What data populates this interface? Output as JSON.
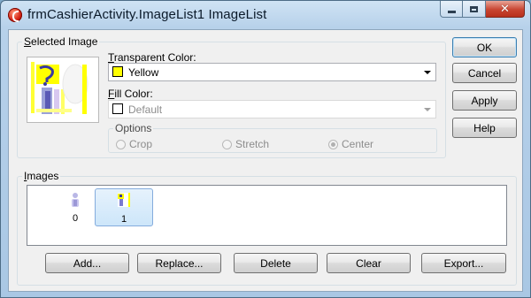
{
  "window": {
    "title": "frmCashierActivity.ImageList1 ImageList",
    "icon": "app-icon"
  },
  "selected_image": {
    "group_label_accel": "S",
    "group_label_rest": "elected Image"
  },
  "transparent_color": {
    "label_accel": "T",
    "label_rest": "ransparent Color:",
    "value": "Yellow",
    "swatch_color": "#ffff00"
  },
  "fill_color": {
    "label_accel": "F",
    "label_rest": "ill Color:",
    "value": "Default",
    "swatch_color": "#ffffff"
  },
  "options": {
    "title": "Options",
    "radios": [
      {
        "label": "Crop",
        "checked": false
      },
      {
        "label": "Stretch",
        "checked": false
      },
      {
        "label": "Center",
        "checked": true
      }
    ]
  },
  "buttons": {
    "ok": "OK",
    "cancel": "Cancel",
    "apply": "Apply",
    "help": "Help"
  },
  "images": {
    "group_label_accel": "I",
    "group_label_rest": "mages",
    "items": [
      {
        "index": "0",
        "selected": false
      },
      {
        "index": "1",
        "selected": true
      }
    ]
  },
  "bottom_buttons": {
    "add": "Add...",
    "replace": "Replace...",
    "delete": "Delete",
    "clear": "Clear",
    "export": "Export..."
  }
}
